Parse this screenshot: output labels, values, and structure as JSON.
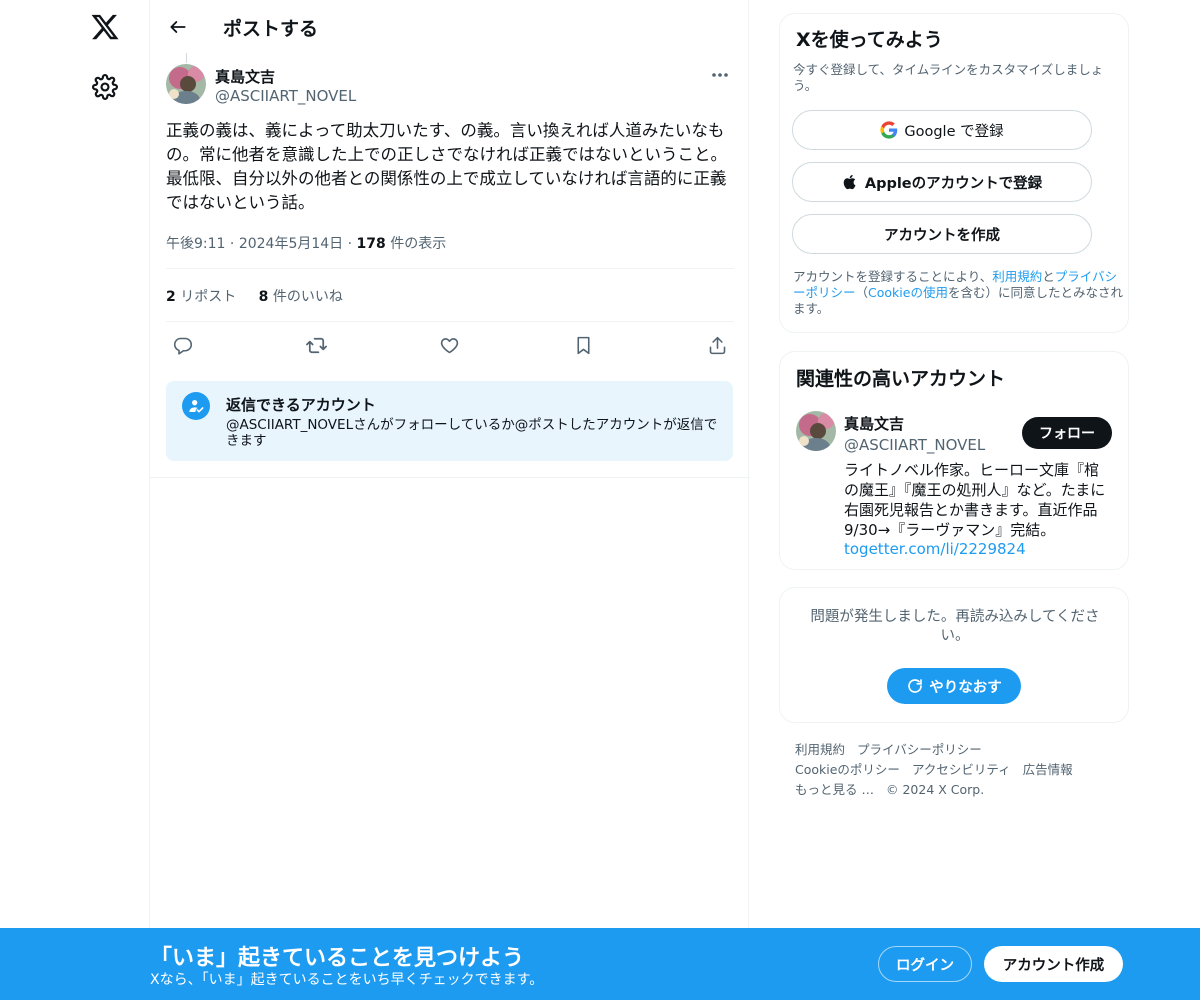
{
  "header": {
    "title": "ポストする"
  },
  "post": {
    "author_name": "真島文吉",
    "author_handle": "@ASCIIART_NOVEL",
    "text": "正義の義は、義によって助太刀いたす、の義。言い換えれば人道みたいなもの。常に他者を意識した上での正しさでなければ正義ではないということ。最低限、自分以外の他者との関係性の上で成立していなければ言語的に正義ではないという話。",
    "time": "午後9:11",
    "date": "2024年5月14日",
    "views_count": "178",
    "views_label": " 件の表示",
    "reposts_count": "2",
    "reposts_label": " リポスト",
    "likes_count": "8",
    "likes_label": " 件のいいね"
  },
  "reply_restriction": {
    "title": "返信できるアカウント",
    "description": "@ASCIIART_NOVELさんがフォローしているか@ポストしたアカウントが返信できます"
  },
  "signup_card": {
    "title": "Xを使ってみよう",
    "subtitle": "今すぐ登録して、タイムラインをカスタマイズしましょう。",
    "google_label": "Google で登録",
    "apple_label": "Appleのアカウントで登録",
    "create_label": "アカウントを作成",
    "terms_prefix": "アカウントを登録することにより、",
    "terms_link": "利用規約",
    "terms_and": "と",
    "privacy_link": "プライバシーポリシー",
    "terms_paren_open": "（",
    "cookie_link": "Cookieの使用",
    "terms_suffix": "を含む）に同意したとみなされます。"
  },
  "relevant_accounts": {
    "title": "関連性の高いアカウント",
    "account": {
      "name": "真島文吉",
      "handle": "@ASCIIART_NOVEL",
      "follow_label": "フォロー",
      "bio": "ライトノベル作家。ヒーロー文庫『棺の魔王』『魔王の処刑人』など。たまに右園死児報告とか書きます。直近作品9/30→『ラーヴァマン』完結。",
      "link": "togetter.com/li/2229824"
    }
  },
  "error_card": {
    "message": "問題が発生しました。再読み込みしてください。",
    "retry_label": "やりなおす"
  },
  "footer": {
    "links": [
      "利用規約",
      "プライバシーポリシー",
      "Cookieのポリシー",
      "アクセシビリティ",
      "広告情報",
      "もっと見る …"
    ],
    "copyright": "© 2024 X Corp."
  },
  "bottom_bar": {
    "title": "「いま」起きていることを見つけよう",
    "subtitle": "Xなら、「いま」起きていることをいち早くチェックできます。",
    "login_label": "ログイン",
    "signup_label": "アカウント作成"
  },
  "colors": {
    "accent": "#1d9bf0",
    "text": "#0f1419",
    "secondary": "#536471",
    "border": "#eff3f4"
  }
}
